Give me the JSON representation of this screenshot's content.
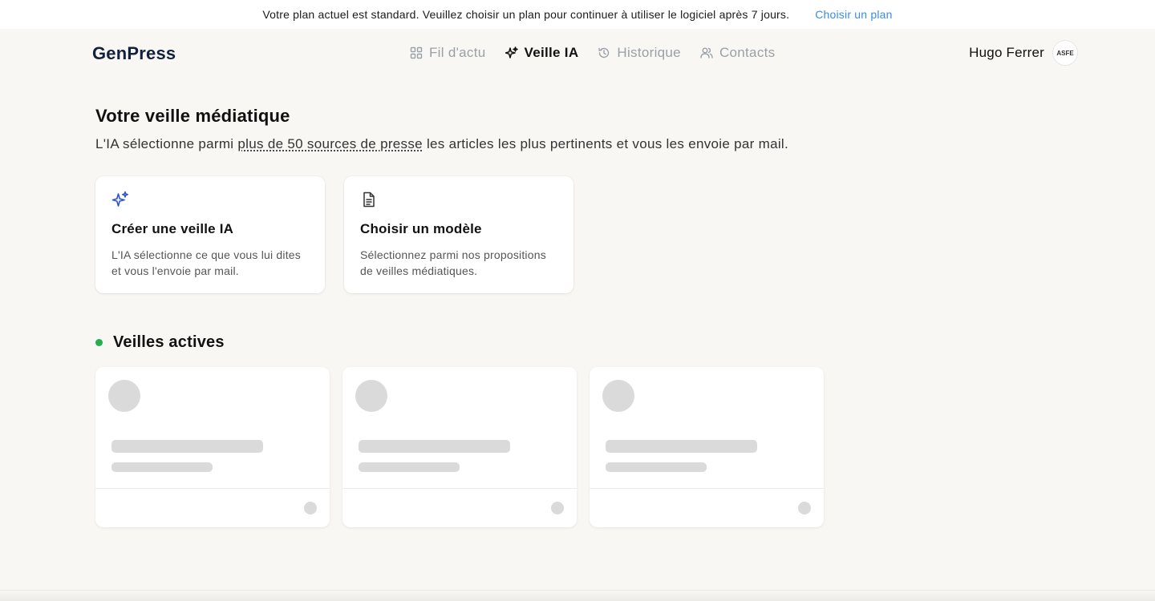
{
  "banner": {
    "message": "Votre plan actuel est standard. Veuillez choisir un plan pour continuer à utiliser le logiciel après 7 jours.",
    "link_label": "Choisir un plan",
    "link_color": "#3b8ed8"
  },
  "header": {
    "logo": "GenPress",
    "nav": [
      {
        "label": "Fil d'actu",
        "icon": "grid-icon",
        "active": false
      },
      {
        "label": "Veille IA",
        "icon": "sparkle-icon",
        "active": true
      },
      {
        "label": "Historique",
        "icon": "history-icon",
        "active": false
      },
      {
        "label": "Contacts",
        "icon": "users-icon",
        "active": false
      }
    ],
    "user": {
      "name": "Hugo Ferrer",
      "avatar_text": "ASFE"
    }
  },
  "main": {
    "title": "Votre veille médiatique",
    "subtitle_prefix": "L'IA sélectionne parmi",
    "subtitle_link": "plus de 50 sources de presse",
    "subtitle_suffix": "les articles les plus pertinents et vous les envoie par mail.",
    "cards": [
      {
        "icon": "sparkle-icon",
        "title": "Créer une veille IA",
        "description": "L'IA sélectionne ce que vous lui dites et vous l'envoie par mail."
      },
      {
        "icon": "document-icon",
        "title": "Choisir un modèle",
        "description": "Sélectionnez parmi nos propositions de veilles médiatiques."
      }
    ],
    "active_section": {
      "title": "Veilles actives",
      "status_color": "#22b04b",
      "skeleton_count": 3
    }
  }
}
